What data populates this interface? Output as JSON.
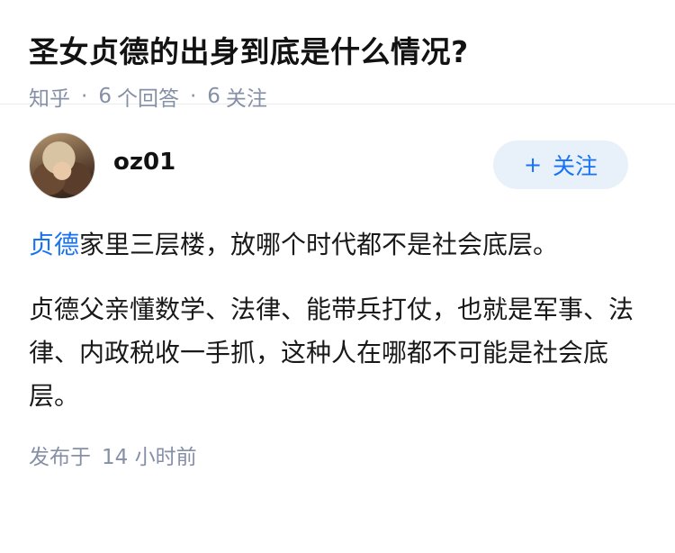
{
  "question": {
    "title": "圣女贞德的出身到底是什么情况?",
    "source": "知乎",
    "answers_count": "6",
    "answers_label": "个回答",
    "followers_count": "6",
    "followers_label": "关注"
  },
  "answer": {
    "author": "oz01",
    "follow_label": "关注",
    "follow_icon": "+",
    "paragraph1_link": "贞德",
    "paragraph1_rest": "家里三层楼，放哪个时代都不是社会底层。",
    "paragraph2": "贞德父亲懂数学、法律、能带兵打仗，也就是军事、法律、内政税收一手抓，这种人在哪都不可能是社会底层。",
    "published_label": "发布于",
    "published_time": "14 小时前"
  },
  "colors": {
    "accent": "#1772f6",
    "meta": "#8590a6",
    "follow_bg": "#e8f0fa"
  }
}
